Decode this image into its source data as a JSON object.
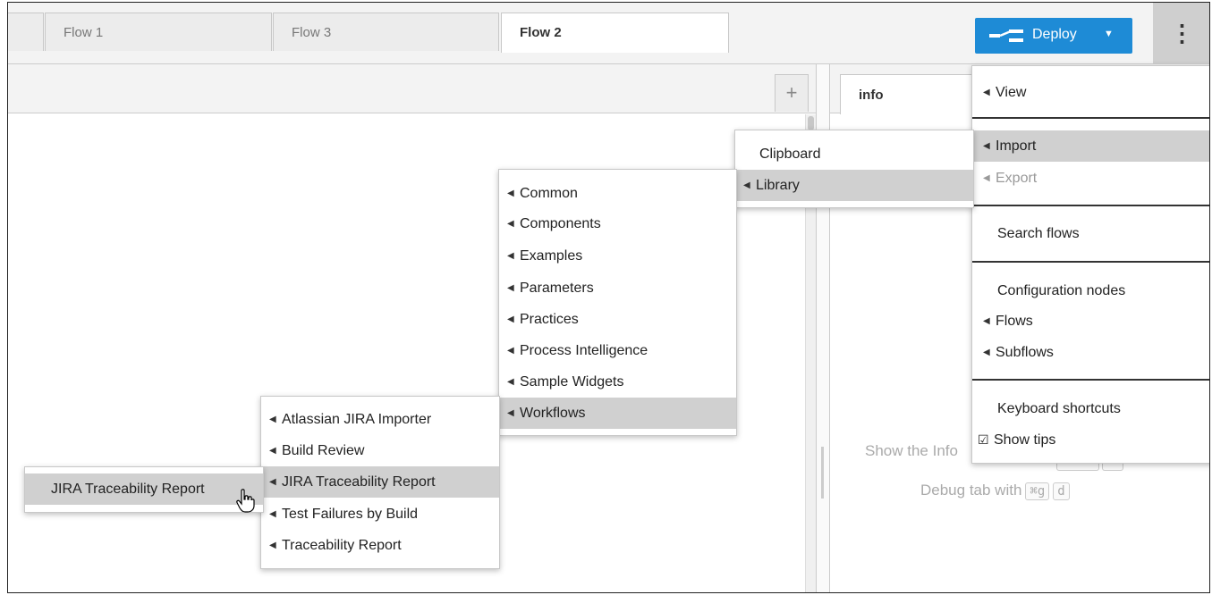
{
  "header": {
    "deploy_label": "Deploy",
    "menu_icon": "ellipsis-vertical-icon"
  },
  "tabs": [
    {
      "label": ""
    },
    {
      "label": "Flow 1"
    },
    {
      "label": "Flow 3"
    },
    {
      "label": "Flow 2",
      "active": true
    }
  ],
  "sidebar": {
    "tab_label": "info",
    "tip_line1": "Show the Info",
    "tip_line2_prefix": "Debug tab with",
    "tip_keys": [
      "⌘g",
      "d"
    ]
  },
  "main_menu": {
    "view": "View",
    "import": "Import",
    "export": "Export",
    "search_flows": "Search flows",
    "configuration_nodes": "Configuration nodes",
    "flows": "Flows",
    "subflows": "Subflows",
    "keyboard_shortcuts": "Keyboard shortcuts",
    "show_tips": "Show tips"
  },
  "import_menu": {
    "clipboard": "Clipboard",
    "library": "Library"
  },
  "library_menu": [
    "Common",
    "Components",
    "Examples",
    "Parameters",
    "Practices",
    "Process Intelligence",
    "Sample Widgets",
    "Workflows"
  ],
  "workflows_menu": [
    "Atlassian JIRA Importer",
    "Build Review",
    "JIRA Traceability Report",
    "Test Failures by Build",
    "Traceability Report"
  ],
  "report_menu": {
    "item": "JIRA Traceability Report"
  }
}
